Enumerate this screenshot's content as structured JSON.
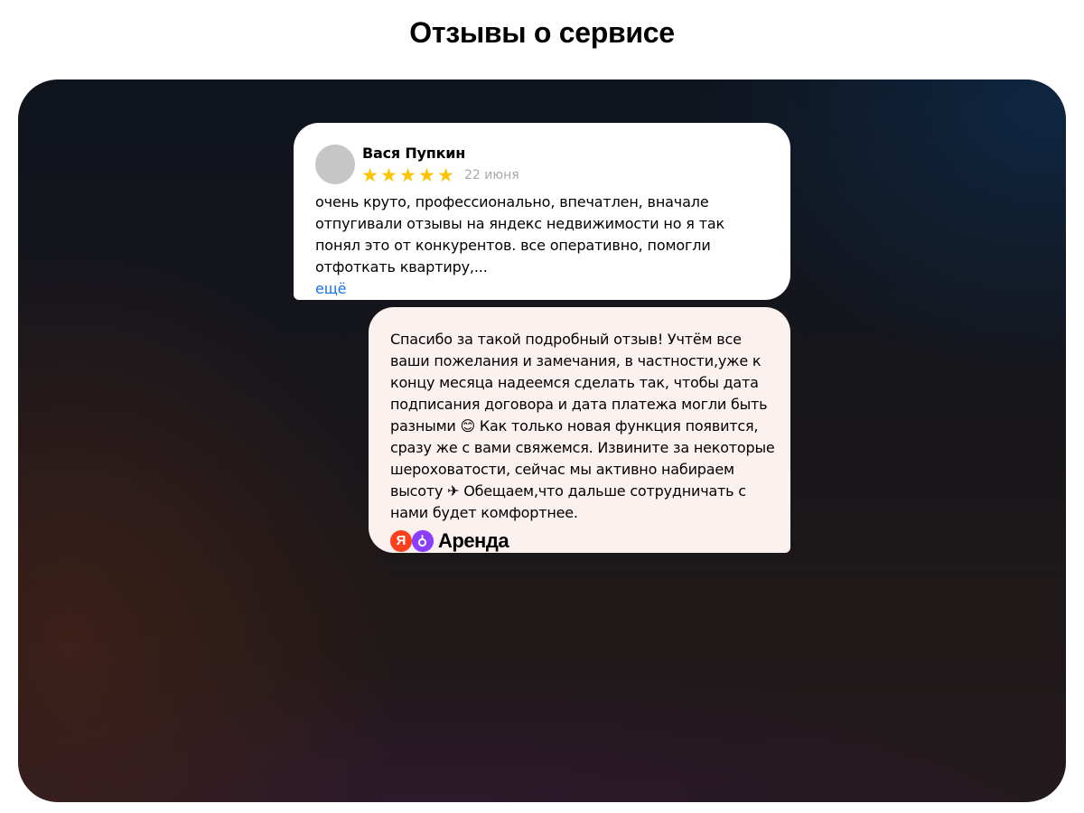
{
  "page": {
    "title": "Отзывы о сервисе"
  },
  "review": {
    "author": "Вася Пупкин",
    "rating": 5,
    "stars": [
      "★",
      "★",
      "★",
      "★",
      "★"
    ],
    "date": "22 июня",
    "text": "очень круто, профессионально, впечатлен, вначале отпугивали отзывы на яндекс недвижимости но я так понял это от конкурентов. все оперативно, помогли отфоткать квартиру,...",
    "more_label": "ещё"
  },
  "reply": {
    "text": "Спасибо за такой подробный отзыв! Учтём все ваши пожелания и замечания, в частности,уже к концу месяца надеемся сделать так, чтобы дата подписания договора и дата платежа могли быть разными 😊 Как только новая функция появится, сразу же с вами свяжемся. Извините за некоторые шероховатости, сейчас мы активно набираем высоту ✈ Обещаем,что дальше сотрудничать с нами будет комфортнее.",
    "brand_letter": "Я",
    "brand_name": "Аренда",
    "brand_icon": "yandex-arenda-logo"
  },
  "colors": {
    "star": "#fcc400",
    "link": "#1a73e8",
    "reply_background": "#fbf1ee",
    "yandex_red": "#fc3f1d",
    "arenda_purple": "#8b3ffd"
  }
}
